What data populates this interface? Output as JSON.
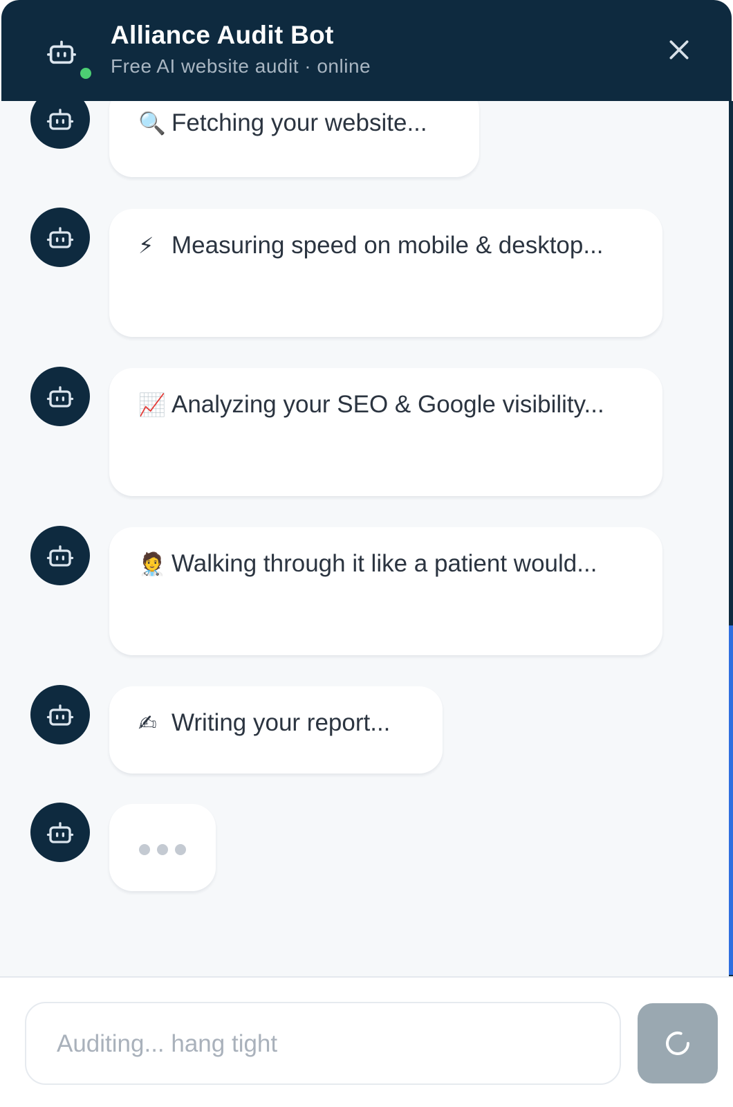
{
  "header": {
    "title": "Alliance Audit Bot",
    "subtitle": "Free AI website audit · online",
    "status_color": "#4ccf73",
    "icon": "robot-icon",
    "close_icon": "close-icon"
  },
  "messages": [
    {
      "emoji": "🔍",
      "icon": "magnifier-icon",
      "text": "Fetching your website..."
    },
    {
      "emoji": "⚡",
      "icon": "lightning-icon",
      "text": "Measuring speed on mobile & desktop..."
    },
    {
      "emoji": "📈",
      "icon": "chart-increasing-icon",
      "text": "Analyzing your SEO & Google visibility..."
    },
    {
      "emoji": "🧑‍⚕️",
      "icon": "health-worker-icon",
      "text": "Walking through it like a patient would..."
    },
    {
      "emoji": "✍",
      "icon": "writing-hand-icon",
      "text": "Writing your report..."
    }
  ],
  "typing_indicator": {
    "dots": 3,
    "icon": "typing-dots-icon"
  },
  "footer": {
    "input_placeholder": "Auditing... hang tight",
    "input_value": "",
    "send_icon": "loading-spinner-icon"
  },
  "colors": {
    "header_bg": "#0e2a3f",
    "chat_bg": "#f6f8fa",
    "bubble_bg": "#ffffff",
    "send_button_bg": "#9aa8b1",
    "scrollbar_accent": "#2f6fe0"
  }
}
